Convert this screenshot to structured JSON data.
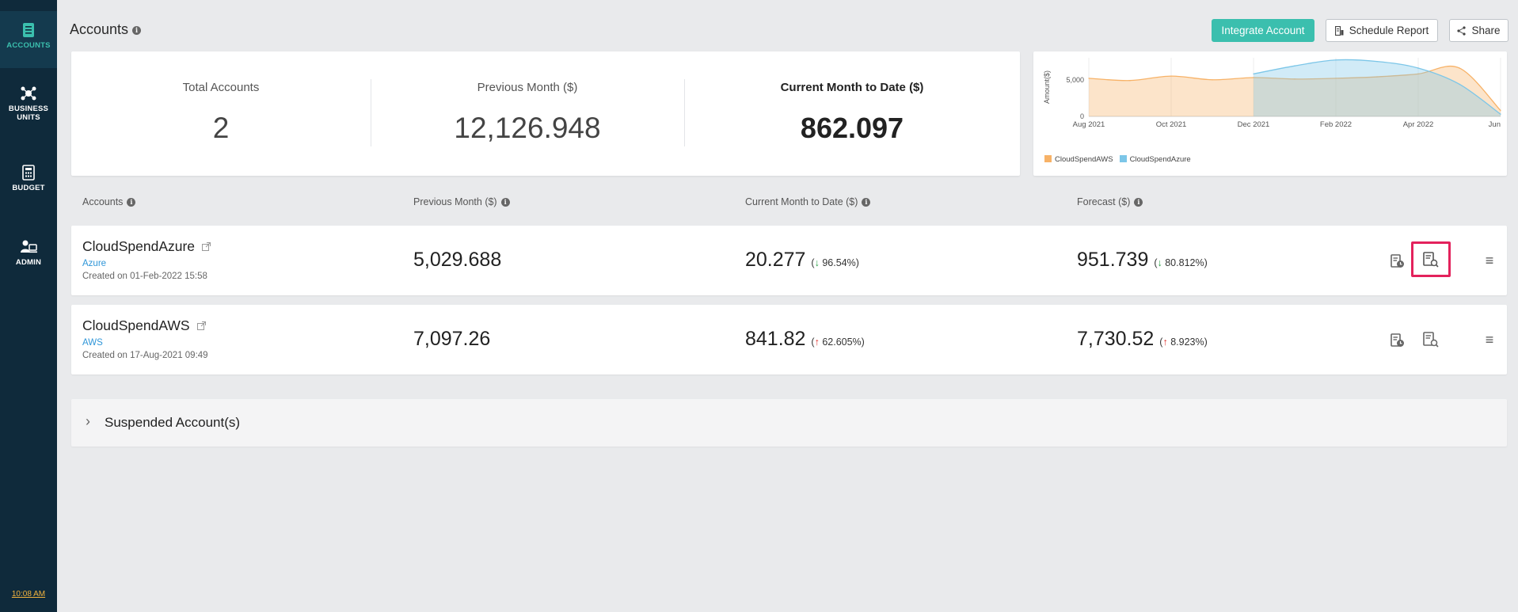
{
  "sidebar": {
    "items": [
      {
        "label": "ACCOUNTS"
      },
      {
        "label_line1": "BUSINESS",
        "label_line2": "UNITS"
      },
      {
        "label": "BUDGET"
      },
      {
        "label": "ADMIN"
      }
    ],
    "time": "10:08 AM"
  },
  "header": {
    "title": "Accounts",
    "integrate_label": "Integrate Account",
    "schedule_label": "Schedule Report",
    "share_label": "Share"
  },
  "summary": {
    "total_accounts_label": "Total Accounts",
    "total_accounts_value": "2",
    "previous_month_label": "Previous Month ($)",
    "previous_month_value": "12,126.948",
    "current_month_label": "Current Month to Date ($)",
    "current_month_value": "862.097"
  },
  "chart_data": {
    "type": "area",
    "ylabel": "Amount($)",
    "y_ticks": [
      "0",
      "5,000"
    ],
    "x_ticks": [
      "Aug 2021",
      "Oct 2021",
      "Dec 2021",
      "Feb 2022",
      "Apr 2022",
      "Jun"
    ],
    "ylim": [
      0,
      8000
    ],
    "x": [
      "Aug 2021",
      "Sep 2021",
      "Oct 2021",
      "Nov 2021",
      "Dec 2021",
      "Jan 2022",
      "Feb 2022",
      "Mar 2022",
      "Apr 2022",
      "May 2022",
      "Jun 2022"
    ],
    "series": [
      {
        "name": "CloudSpendAWS",
        "color": "#f7b267",
        "values": [
          5200,
          4900,
          5500,
          5000,
          5300,
          5100,
          5200,
          5400,
          5800,
          6600,
          800
        ]
      },
      {
        "name": "CloudSpendAzure",
        "color": "#7cc6e8",
        "values": [
          null,
          null,
          null,
          null,
          5800,
          6900,
          7700,
          7500,
          6600,
          4400,
          300
        ]
      }
    ],
    "legend_position": "bottom-left",
    "grid": true
  },
  "table": {
    "headers": {
      "accounts": "Accounts",
      "previous_month": "Previous Month ($)",
      "current_month": "Current Month to Date ($)",
      "forecast": "Forecast ($)"
    },
    "rows": [
      {
        "name": "CloudSpendAzure",
        "type": "Azure",
        "created": "Created on 01-Feb-2022 15:58",
        "previous_month": "5,029.688",
        "current_month": "20.277",
        "current_change_dir": "down",
        "current_change_open": "(",
        "current_change_pct": "96.54%)",
        "forecast": "951.739",
        "forecast_change_dir": "down",
        "forecast_change_open": "(",
        "forecast_change_pct": "80.812%)"
      },
      {
        "name": "CloudSpendAWS",
        "type": "AWS",
        "created": "Created on 17-Aug-2021 09:49",
        "previous_month": "7,097.26",
        "current_month": "841.82",
        "current_change_dir": "up",
        "current_change_open": "(",
        "current_change_pct": "62.605%)",
        "forecast": "7,730.52",
        "forecast_change_dir": "up",
        "forecast_change_open": "(",
        "forecast_change_pct": "8.923%)"
      }
    ]
  },
  "suspended": {
    "label": "Suspended Account(s)"
  },
  "colors": {
    "sidebar_bg": "#0f2a3b",
    "accent": "#3bbfae",
    "highlight": "#e3225c",
    "link": "#2f96d8"
  }
}
